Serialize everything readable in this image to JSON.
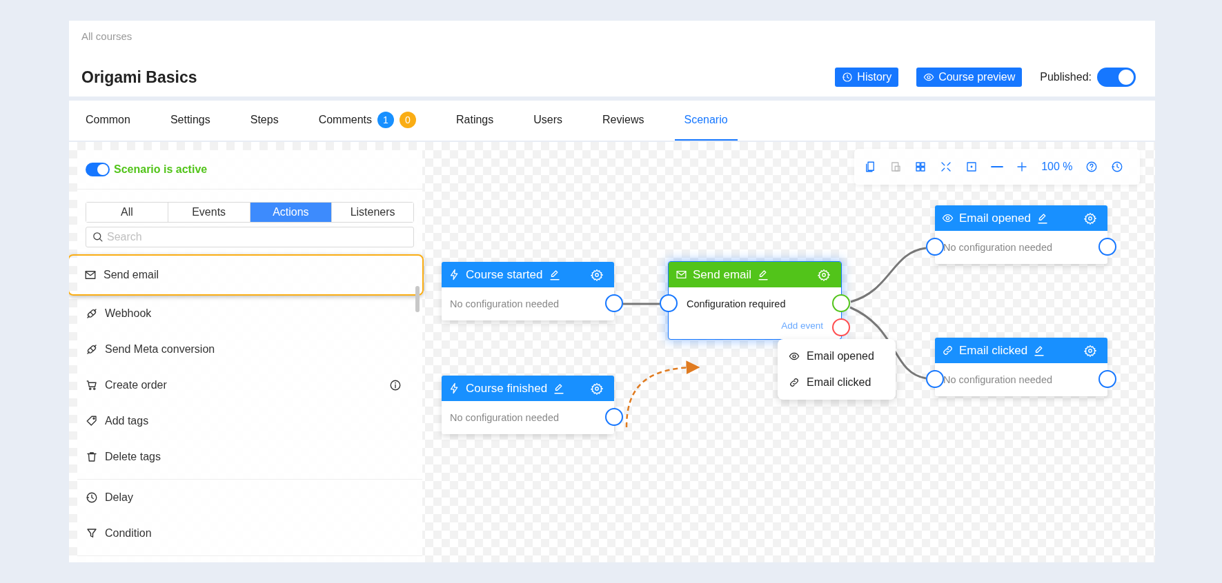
{
  "header": {
    "breadcrumb": "All courses",
    "title": "Origami Basics",
    "buttons": [
      {
        "label": "History"
      },
      {
        "label": "Course preview"
      }
    ],
    "published": {
      "label": "Published:",
      "on": true
    }
  },
  "tabs": [
    {
      "label": "Common",
      "selected": false
    },
    {
      "label": "Settings",
      "selected": false
    },
    {
      "label": "Steps",
      "selected": false
    },
    {
      "label": "Comments",
      "selected": false,
      "badges": [
        {
          "text": "1",
          "color": "#1890ff"
        },
        {
          "text": "0",
          "color": "#faad14"
        }
      ]
    },
    {
      "label": "Ratings",
      "selected": false
    },
    {
      "label": "Users",
      "selected": false
    },
    {
      "label": "Reviews",
      "selected": false
    },
    {
      "label": "Scenario",
      "selected": true
    }
  ],
  "sidebar": {
    "toggle": {
      "label": "Scenario is active",
      "on": true
    },
    "filters": [
      {
        "label": "All",
        "selected": false
      },
      {
        "label": "Events",
        "selected": false
      },
      {
        "label": "Actions",
        "selected": true
      },
      {
        "label": "Listeners",
        "selected": false
      }
    ],
    "search": {
      "placeholder": "Search"
    },
    "groups": [
      [
        {
          "label": "Send email",
          "selected": true,
          "info": false
        },
        {
          "label": "Webhook",
          "selected": false,
          "info": false
        },
        {
          "label": "Send Meta conversion",
          "selected": false,
          "info": false
        },
        {
          "label": "Create order",
          "selected": false,
          "info": true
        },
        {
          "label": "Add tags",
          "selected": false,
          "info": false
        },
        {
          "label": "Delete tags",
          "selected": false,
          "info": false
        }
      ],
      [
        {
          "label": "Delay",
          "selected": false,
          "info": false
        },
        {
          "label": "Condition",
          "selected": false,
          "info": false
        }
      ]
    ]
  },
  "toolbar": [
    {
      "kind": "icon",
      "disabled": false
    },
    {
      "kind": "icon",
      "disabled": true
    },
    {
      "kind": "icon",
      "disabled": false
    },
    {
      "kind": "icon",
      "disabled": false
    },
    {
      "kind": "icon",
      "disabled": false
    },
    {
      "kind": "icon",
      "disabled": false
    },
    {
      "kind": "icon",
      "disabled": false
    },
    {
      "kind": "text",
      "label": "100 %"
    },
    {
      "kind": "icon",
      "disabled": false
    },
    {
      "kind": "icon",
      "disabled": false
    }
  ],
  "nodes": [
    {
      "title": "Course started",
      "kind": "trigger",
      "selected": false,
      "body": "No configuration needed",
      "required": false
    },
    {
      "title": "Course finished",
      "kind": "trigger",
      "selected": false,
      "body": "No configuration needed",
      "required": false
    },
    {
      "title": "Send email",
      "kind": "action",
      "selected": true,
      "body": "Configuration required",
      "required": true,
      "link": "Add event"
    },
    {
      "title": "Email opened",
      "kind": "trigger",
      "selected": false,
      "body": "No configuration needed",
      "required": false
    },
    {
      "title": "Email clicked",
      "kind": "trigger",
      "selected": false,
      "body": "No configuration needed",
      "required": false
    }
  ],
  "popup_menu": [
    {
      "label": "Email opened"
    },
    {
      "label": "Email clicked"
    }
  ]
}
